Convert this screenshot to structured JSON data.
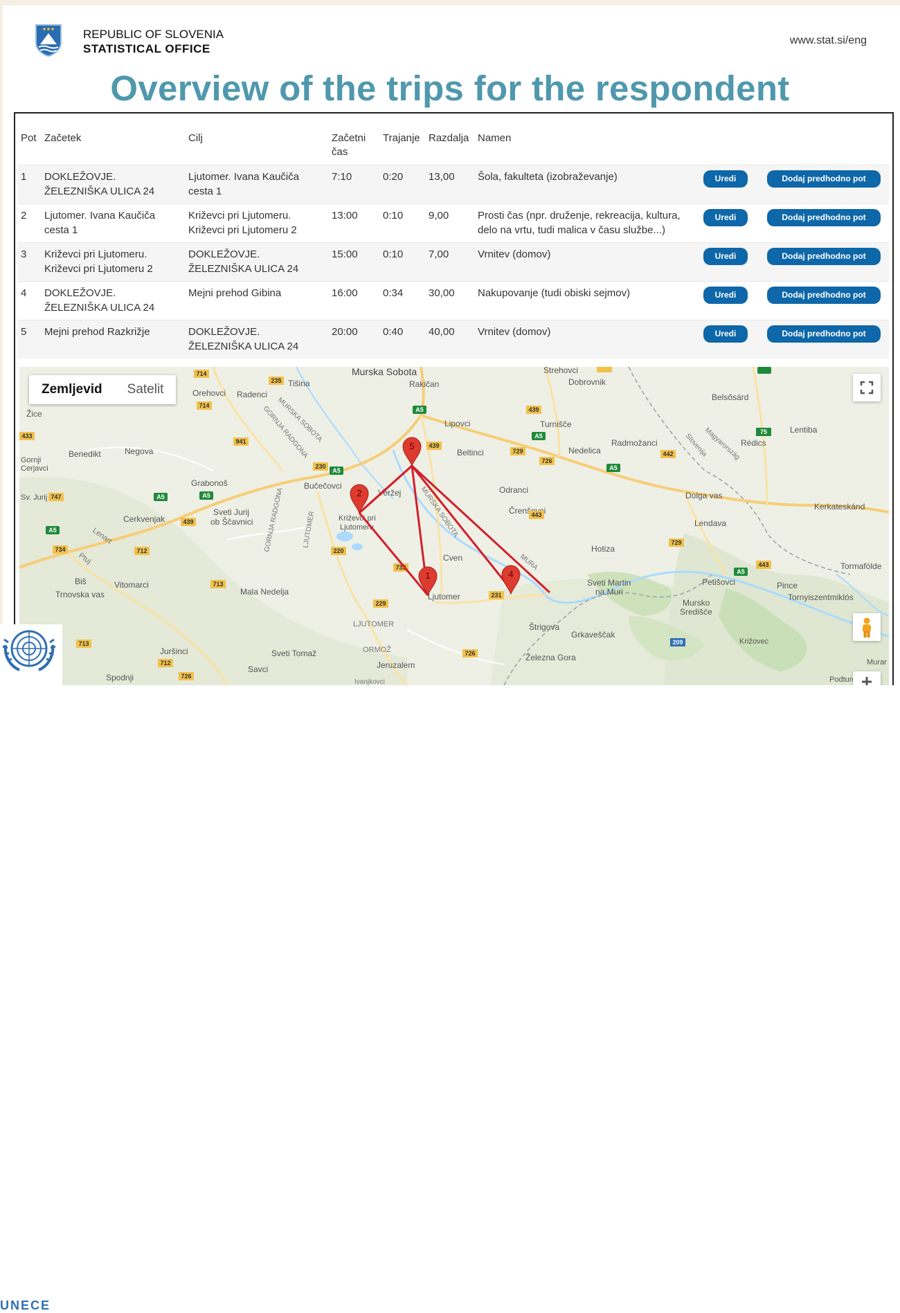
{
  "header": {
    "org_line1": "REPUBLIC OF SLOVENIA",
    "org_line2": "STATISTICAL OFFICE",
    "website": "www.stat.si/eng"
  },
  "title": "Overview of the trips for the respondent",
  "table": {
    "columns": {
      "pot": "Pot",
      "zacetek": "Začetek",
      "cilj": "Cilj",
      "zacetni_cas_1": "Začetni",
      "zacetni_cas_2": "čas",
      "trajanje": "Trajanje",
      "razdalja": "Razdalja",
      "namen": "Namen"
    },
    "edit_label": "Uredi",
    "add_label": "Dodaj predhodno pot",
    "rows": [
      {
        "pot": "1",
        "start1": "DOKLEŽOVJE.",
        "start2": "ŽELEZNIŠKA ULICA 24",
        "dest1": "Ljutomer. Ivana Kaučiča",
        "dest2": "cesta 1",
        "time": "7:10",
        "duration": "0:20",
        "distance": "13,00",
        "purpose1": "Šola, fakulteta (izobraževanje)",
        "purpose2": ""
      },
      {
        "pot": "2",
        "start1": "Ljutomer. Ivana Kaučiča",
        "start2": "cesta 1",
        "dest1": "Križevci pri Ljutomeru.",
        "dest2": "Križevci pri Ljutomeru 2",
        "time": "13:00",
        "duration": "0:10",
        "distance": "9,00",
        "purpose1": "Prosti čas (npr. druženje, rekreacija, kultura,",
        "purpose2": "delo na vrtu, tudi malica v času službe...)"
      },
      {
        "pot": "3",
        "start1": "Križevci pri Ljutomeru.",
        "start2": "Križevci pri Ljutomeru 2",
        "dest1": "DOKLEŽOVJE.",
        "dest2": "ŽELEZNIŠKA ULICA 24",
        "time": "15:00",
        "duration": "0:10",
        "distance": "7,00",
        "purpose1": "Vrnitev (domov)",
        "purpose2": ""
      },
      {
        "pot": "4",
        "start1": "DOKLEŽOVJE.",
        "start2": "ŽELEZNIŠKA ULICA 24",
        "dest1": "Mejni prehod Gibina",
        "dest2": "",
        "time": "16:00",
        "duration": "0:34",
        "distance": "30,00",
        "purpose1": "Nakupovanje (tudi obiski sejmov)",
        "purpose2": ""
      },
      {
        "pot": "5",
        "start1": "Mejni prehod Razkrižje",
        "start2": "",
        "dest1": "DOKLEŽOVJE.",
        "dest2": "ŽELEZNIŠKA ULICA 24",
        "time": "20:00",
        "duration": "0:40",
        "distance": "40,00",
        "purpose1": "Vrnitev (domov)",
        "purpose2": ""
      }
    ]
  },
  "map": {
    "type_map": "Zemljevid",
    "type_satellite": "Satelit",
    "markers": [
      "5",
      "2",
      "1",
      "4"
    ],
    "places": [
      "Murska Sobota",
      "Rakičan",
      "Tišina",
      "Strehovci",
      "Dobrovnik",
      "Orehovci",
      "Radenci",
      "MURSKA SOBOTA",
      "GORNJA RADGONA",
      "Lipovci",
      "Turnišče",
      "Belsősárd",
      "Lentiba",
      "Rédics",
      "Radmožanci",
      "Nedelica",
      "Beltinci",
      "Negova",
      "Benedikt",
      "Grabonoš",
      "Bučečovci",
      "Veržej",
      "Odranci",
      "Črenšovci",
      "Dolga vas",
      "Lendava",
      "Kerkateskánd",
      "Sveti Jurij",
      "ob Ščavnici",
      "Cerkvenjak",
      "Križevci pri",
      "Ljutomeru",
      "Cven",
      "Hotiza",
      "Sveti Martin",
      "na Muri",
      "Petišovci",
      "Tormafölde",
      "Pince",
      "Tornyiszentmiklós",
      "Mursko",
      "Središće",
      "Mala Nedelja",
      "Vitomarci",
      "Trnovska vas",
      "Biš",
      "Ljutomer",
      "Štrigova",
      "Grkaveščak",
      "Železna Gora",
      "Križovec",
      "Murar",
      "Podturen",
      "Juršinci",
      "Sveti Tomaž",
      "Savci",
      "Jeruzalem",
      "Spodnji",
      "LJUTOMER",
      "ORMOŽ",
      "LJUTOMER",
      "Žice",
      "Gornji",
      "Cerjavci",
      "Sv. Jurij",
      "Lenart",
      "Ptuj",
      "Slovenija",
      "Magyarország",
      "GORNJA RADGONA",
      "LJUTOMER",
      "MURSKA SOBOTA",
      "MURA",
      "Ivanjkovci"
    ],
    "roads": [
      "714",
      "235",
      "439",
      "714",
      "941",
      "230",
      "747",
      "439",
      "729",
      "726",
      "442",
      "75",
      "433",
      "442",
      "443",
      "729",
      "220",
      "734",
      "712",
      "713",
      "229",
      "712",
      "713",
      "209",
      "726",
      "231",
      "726",
      "747",
      "443",
      "443",
      "220",
      "733",
      "439",
      "A5",
      "A5",
      "A5",
      "A5",
      "A5",
      "A5",
      "A5",
      "A5",
      "A5"
    ]
  },
  "footer": {
    "unece": "UNECE"
  },
  "colors": {
    "title": "#4f98ad",
    "button": "#0d67a8",
    "route": "#d21f2a",
    "marker": "#dd3b30",
    "water": "#aadaff",
    "map_bg": "#eef0e6"
  }
}
